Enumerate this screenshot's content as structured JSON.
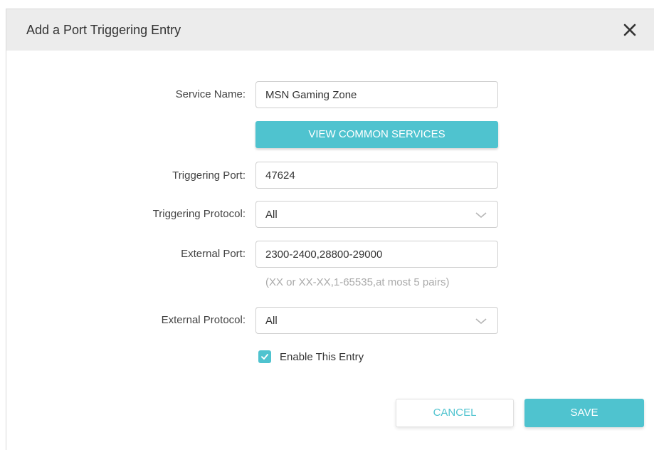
{
  "dialog": {
    "title": "Add a Port Triggering Entry",
    "close_icon": "close-icon"
  },
  "form": {
    "service_name": {
      "label": "Service Name:",
      "value": "MSN Gaming Zone"
    },
    "view_services_label": "VIEW COMMON SERVICES",
    "triggering_port": {
      "label": "Triggering Port:",
      "value": "47624"
    },
    "triggering_protocol": {
      "label": "Triggering Protocol:",
      "value": "All",
      "icon": "chevron-down-icon"
    },
    "external_port": {
      "label": "External Port:",
      "value": "2300-2400,28800-29000",
      "hint": "(XX or XX-XX,1-65535,at most 5 pairs)"
    },
    "external_protocol": {
      "label": "External Protocol:",
      "value": "All",
      "icon": "chevron-down-icon"
    },
    "enable_entry": {
      "label": "Enable This Entry",
      "checked": true,
      "icon": "checkmark-icon"
    }
  },
  "actions": {
    "cancel_label": "CANCEL",
    "save_label": "SAVE"
  },
  "colors": {
    "accent": "#4fc3cf",
    "header_bg": "#ececec",
    "hint_text": "#aaaaaa"
  }
}
